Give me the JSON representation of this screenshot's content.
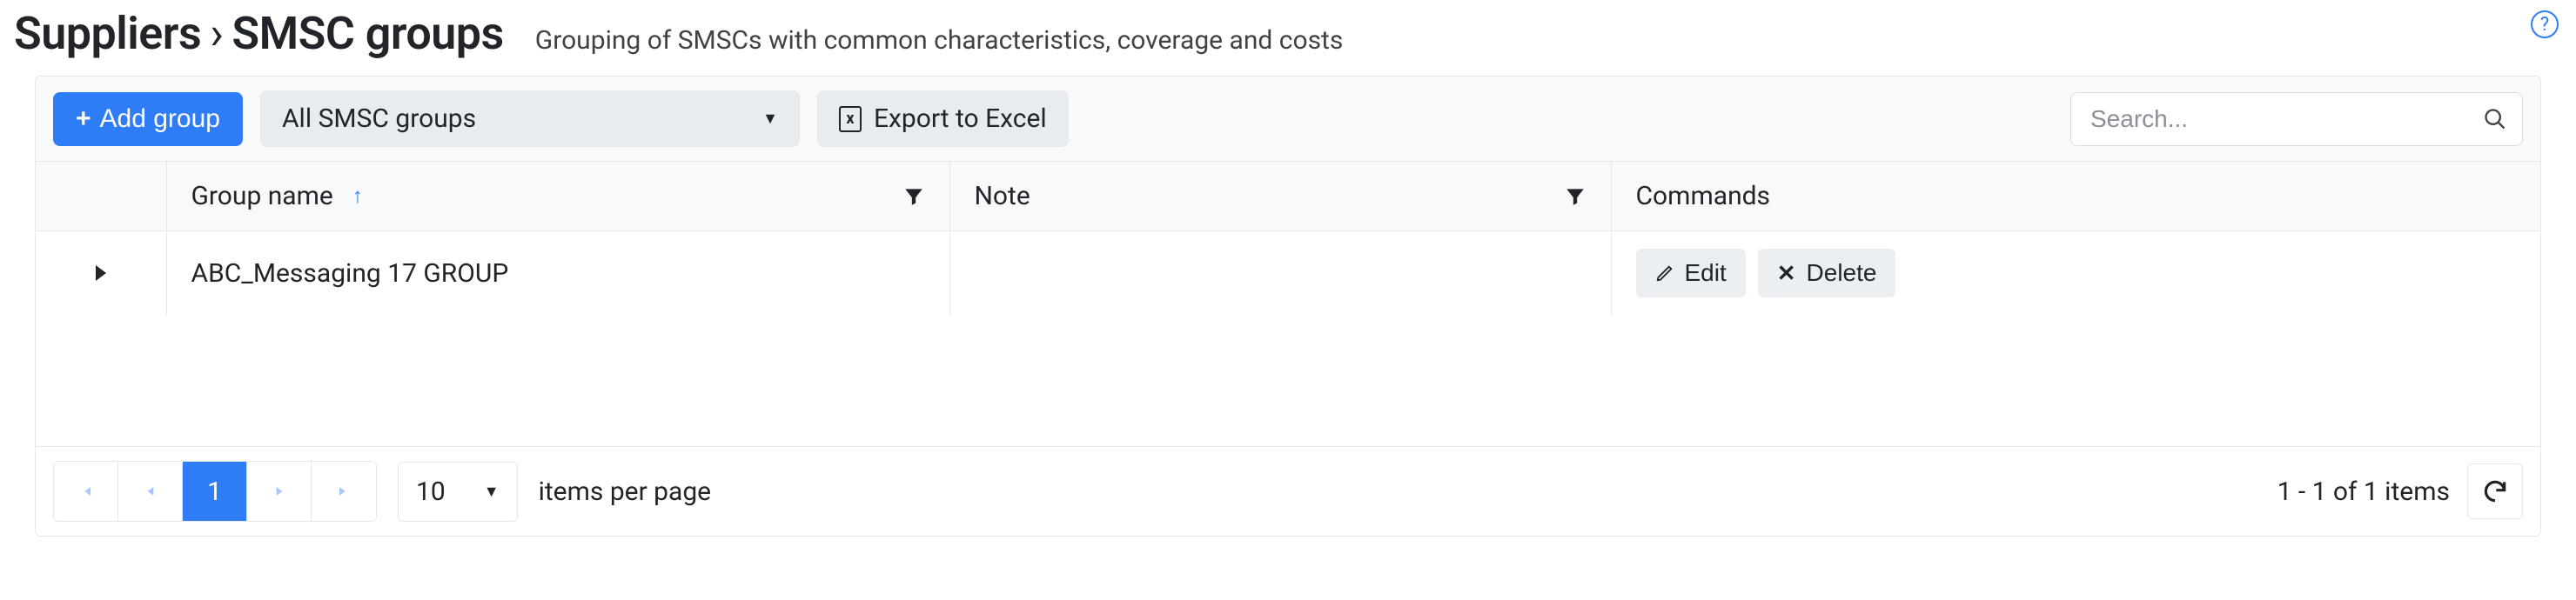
{
  "header": {
    "breadcrumb_parent": "Suppliers",
    "breadcrumb_current": "SMSC groups",
    "subtitle": "Grouping of SMSCs with common characteristics, coverage and costs"
  },
  "toolbar": {
    "add_group_label": "Add group",
    "filter_dropdown_selected": "All SMSC groups",
    "export_label": "Export to Excel",
    "search_placeholder": "Search..."
  },
  "grid": {
    "columns": {
      "group_name": "Group name",
      "note": "Note",
      "commands": "Commands"
    },
    "rows": [
      {
        "group_name": "ABC_Messaging 17 GROUP",
        "note": "",
        "edit_label": "Edit",
        "delete_label": "Delete"
      }
    ]
  },
  "pager": {
    "current_page": "1",
    "page_size": "10",
    "items_per_page_label": "items per page",
    "summary": "1 - 1 of 1 items"
  }
}
